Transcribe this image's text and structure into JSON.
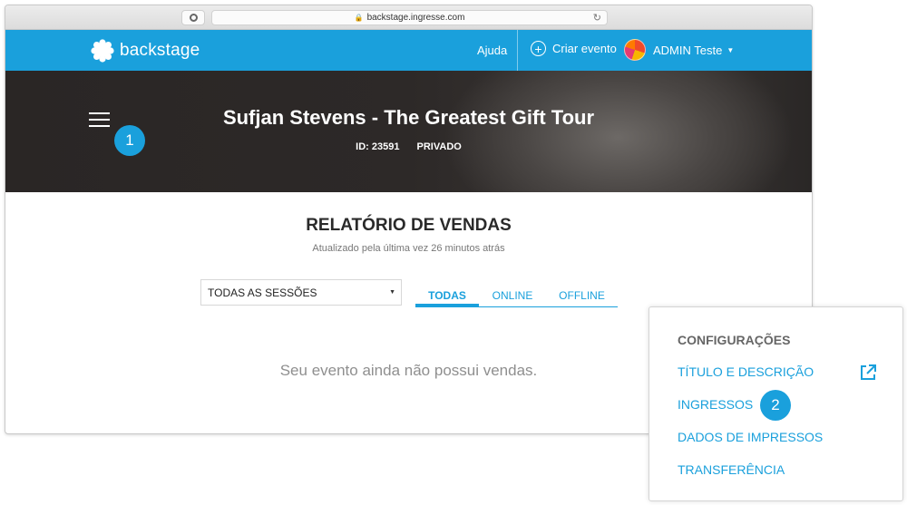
{
  "browser": {
    "url": "backstage.ingresse.com"
  },
  "topbar": {
    "brand": "backstage",
    "help": "Ajuda",
    "create_event": "Criar evento",
    "user_name": "ADMIN Teste"
  },
  "event": {
    "title": "Sufjan Stevens - The Greatest Gift Tour",
    "id_label": "ID: 23591",
    "visibility": "PRIVADO"
  },
  "report": {
    "title": "RELATÓRIO DE VENDAS",
    "updated": "Atualizado pela última vez 26 minutos atrás",
    "session_select": "TODAS AS SESSÕES",
    "tabs": [
      "TODAS",
      "ONLINE",
      "OFFLINE"
    ],
    "empty": "Seu evento ainda não possui vendas."
  },
  "config": {
    "heading": "CONFIGURAÇÕES",
    "items": [
      "TÍTULO E DESCRIÇÃO",
      "INGRESSOS",
      "DADOS DE IMPRESSOS",
      "TRANSFERÊNCIA"
    ]
  },
  "callouts": [
    "1",
    "2"
  ],
  "colors": {
    "accent": "#1aa0dc",
    "hero_bg": "#2a2625"
  }
}
